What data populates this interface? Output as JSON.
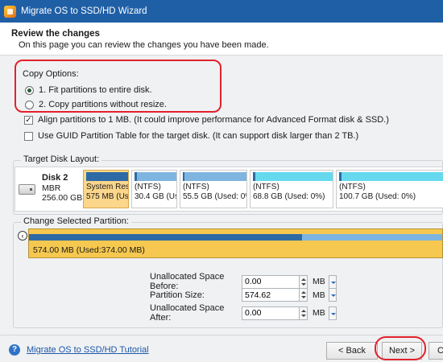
{
  "window": {
    "title": "Migrate OS to SSD/HD Wizard"
  },
  "header": {
    "title": "Review the changes",
    "subtitle": "On this page you can review the changes you have been made."
  },
  "copy_options": {
    "label": "Copy Options:",
    "options": [
      {
        "label": "1. Fit partitions to entire disk.",
        "selected": true
      },
      {
        "label": "2. Copy partitions without resize.",
        "selected": false
      }
    ]
  },
  "checkboxes": [
    {
      "label": "Align partitions to 1 MB.  (It could improve performance for Advanced Format disk & SSD.)",
      "checked": true
    },
    {
      "label": "Use GUID Partition Table for the target disk. (It can support disk larger than 2 TB.)",
      "checked": false
    }
  ],
  "target_disk": {
    "label": "Target Disk Layout:",
    "disk": {
      "name": "Disk 2",
      "type": "MBR",
      "size": "256.00 GB"
    },
    "partitions": [
      {
        "line1": "System Rese",
        "line2": "575 MB (Use",
        "bar_color": "#2d6aa5",
        "used_color": "#2d6aa5",
        "used_fraction": 1.0,
        "selected": true
      },
      {
        "line1": "(NTFS)",
        "line2": "30.4 GB (Use",
        "bar_color": "#7eb4e0",
        "used_color": "#2d6aa5",
        "used_fraction": 0.05,
        "selected": false
      },
      {
        "line1": "(NTFS)",
        "line2": "55.5 GB (Used: 0%",
        "bar_color": "#7eb4e0",
        "used_color": "#2d6aa5",
        "used_fraction": 0.03,
        "selected": false
      },
      {
        "line1": "(NTFS)",
        "line2": "68.8 GB (Used: 0%)",
        "bar_color": "#66d9ee",
        "used_color": "#2d6aa5",
        "used_fraction": 0.03,
        "selected": false
      },
      {
        "line1": "(NTFS)",
        "line2": "100.7 GB (Used: 0%)",
        "bar_color": "#66d9ee",
        "used_color": "#2d6aa5",
        "used_fraction": 0.02,
        "selected": false
      }
    ]
  },
  "change_partition": {
    "label": "Change Selected Partition:",
    "bar_label": "574.00 MB (Used:374.00 MB)",
    "used_fraction": 0.66,
    "fields": [
      {
        "label": "Unallocated Space Before:",
        "value": "0.00",
        "unit": "MB"
      },
      {
        "label": "Partition Size:",
        "value": "574.62",
        "unit": "MB"
      },
      {
        "label": "Unallocated Space After:",
        "value": "0.00",
        "unit": "MB"
      }
    ]
  },
  "footer": {
    "tutorial": "Migrate OS to SSD/HD Tutorial",
    "back": "< Back",
    "next": "Next >",
    "cancel": "C"
  }
}
